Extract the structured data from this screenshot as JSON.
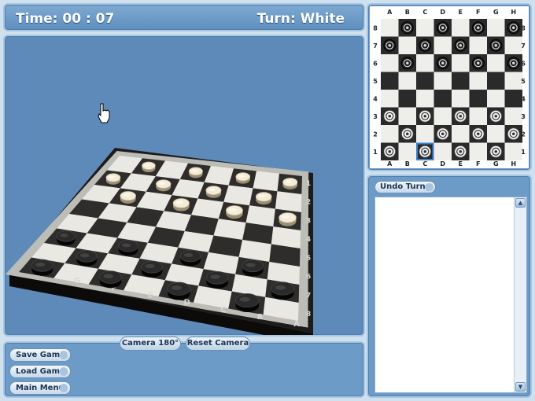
{
  "status": {
    "time_label": "Time: 00 : 07",
    "turn_label": "Turn: White"
  },
  "camera": {
    "rotate_label": "Camera 180°",
    "reset_label": "Reset Camera"
  },
  "menu": {
    "save_label": "Save Game",
    "load_label": "Load Game",
    "main_label": "Main Menu"
  },
  "moves": {
    "undo_label": "Undo Turn",
    "entries": []
  },
  "board": {
    "files": [
      "A",
      "B",
      "C",
      "D",
      "E",
      "F",
      "G",
      "H"
    ],
    "ranks": [
      "8",
      "7",
      "6",
      "5",
      "4",
      "3",
      "2",
      "1"
    ],
    "black_pieces": [
      "B8",
      "D8",
      "F8",
      "H8",
      "A7",
      "C7",
      "E7",
      "G7",
      "B6",
      "D6",
      "F6",
      "H6"
    ],
    "white_pieces": [
      "A3",
      "C3",
      "E3",
      "G3",
      "B2",
      "D2",
      "F2",
      "H2",
      "A1",
      "C1",
      "E1",
      "G1"
    ],
    "highlighted_square": "C1"
  },
  "colors": {
    "light_square": "#eeeeea",
    "dark_square": "#2a2a2a",
    "viewport_bg": "#5e8ab9",
    "panel_bg": "#6d9bc8"
  },
  "icons": {
    "cursor": "hand-pointer-icon",
    "scroll_up": "triangle-up-icon",
    "scroll_down": "triangle-down-icon"
  }
}
